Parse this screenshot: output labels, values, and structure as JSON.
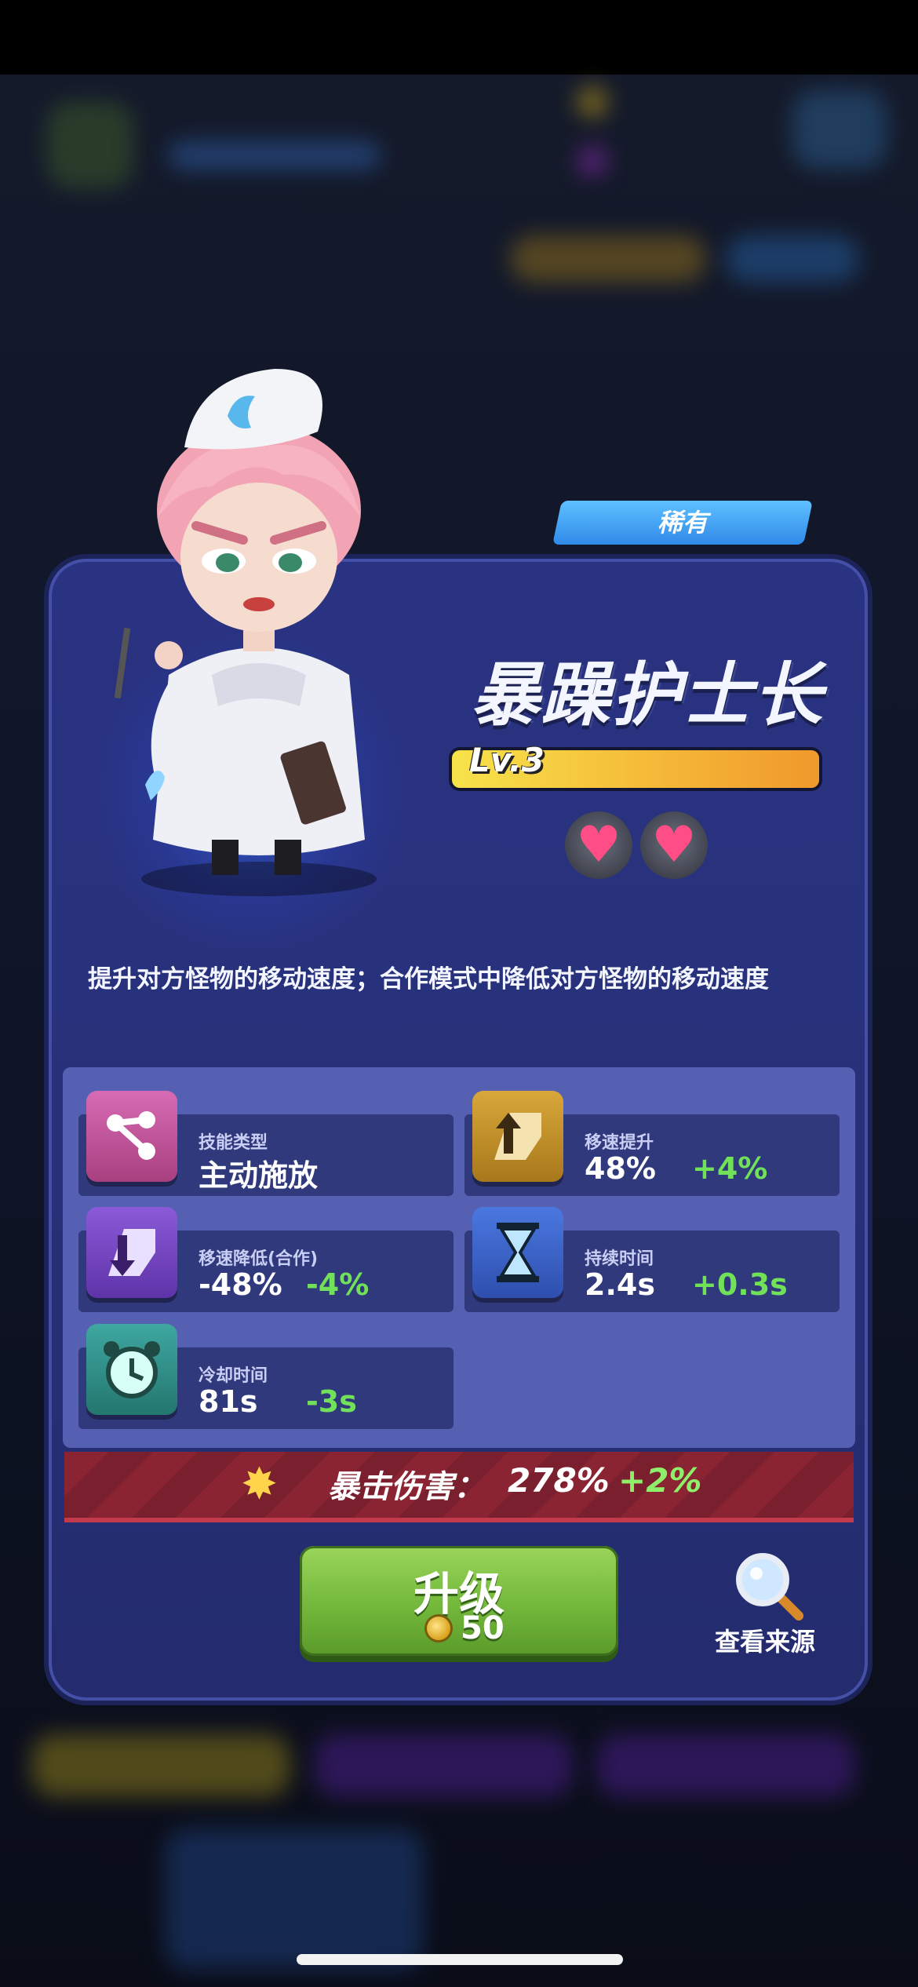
{
  "hero": {
    "rarity": "稀有",
    "name": "暴躁护士长",
    "level_label": "Lv.3",
    "description": "提升对方怪物的移动速度；合作模式中降低对方怪物的移动速度"
  },
  "stats": [
    {
      "label": "技能类型",
      "value": "主动施放",
      "delta": ""
    },
    {
      "label": "移速提升",
      "value": "48%",
      "delta": "+4%"
    },
    {
      "label": "移速降低(合作)",
      "value": "-48%",
      "delta": "-4%"
    },
    {
      "label": "持续时间",
      "value": "2.4s",
      "delta": "+0.3s"
    },
    {
      "label": "冷却时间",
      "value": "81s",
      "delta": "-3s"
    }
  ],
  "crit": {
    "label": "暴击伤害：",
    "value": "278%",
    "delta": "+2%"
  },
  "upgrade": {
    "label": "升级",
    "cost": "50"
  },
  "source": {
    "label": "查看来源"
  },
  "colors": {
    "accent_green": "#72e15a",
    "panel": "#2a3382",
    "bar_yellow": "#f5b938"
  },
  "icons": [
    "share-icon",
    "speed-up-icon",
    "speed-down-icon",
    "hourglass-icon",
    "alarm-clock-icon",
    "burst-icon",
    "coin-icon",
    "magnifier-icon",
    "heart-icon"
  ]
}
